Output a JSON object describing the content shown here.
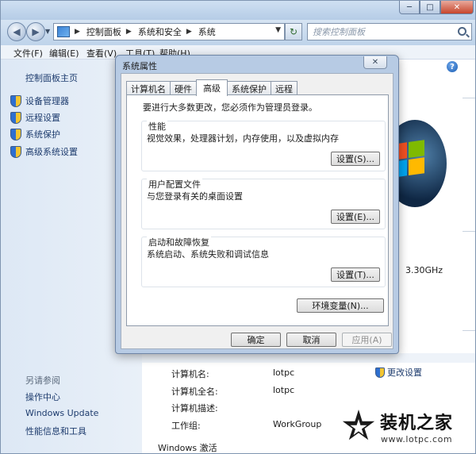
{
  "window": {
    "breadcrumbs": [
      "控制面板",
      "系统和安全",
      "系统"
    ],
    "search_placeholder": "搜索控制面板"
  },
  "menu": [
    "文件(F)",
    "编辑(E)",
    "查看(V)",
    "工具(T)",
    "帮助(H)"
  ],
  "sidebar": {
    "home": "控制面板主页",
    "items": [
      "设备管理器",
      "远程设置",
      "系统保护",
      "高级系统设置"
    ],
    "see_also_title": "另请参阅",
    "see_also": [
      "操作中心",
      "Windows Update",
      "性能信息和工具"
    ]
  },
  "main": {
    "cpu_speed": "3.30GHz",
    "computer_info": [
      {
        "label": "计算机名:",
        "value": "lotpc"
      },
      {
        "label": "计算机全名:",
        "value": "lotpc"
      },
      {
        "label": "计算机描述:",
        "value": ""
      },
      {
        "label": "工作组:",
        "value": "WorkGroup"
      }
    ],
    "change_settings": "更改设置",
    "activation": "Windows 激活"
  },
  "watermark": {
    "title": "装机之家",
    "url": "www.lotpc.com"
  },
  "dialog": {
    "title": "系统属性",
    "tabs": [
      "计算机名",
      "硬件",
      "高级",
      "系统保护",
      "远程"
    ],
    "active_tab": "高级",
    "admin_note": "要进行大多数更改，您必须作为管理员登录。",
    "performance": {
      "title": "性能",
      "desc": "视觉效果，处理器计划，内存使用，以及虚拟内存",
      "button": "设置(S)..."
    },
    "user_profiles": {
      "title": "用户配置文件",
      "desc": "与您登录有关的桌面设置",
      "button": "设置(E)..."
    },
    "startup": {
      "title": "启动和故障恢复",
      "desc": "系统启动、系统失败和调试信息",
      "button": "设置(T)..."
    },
    "env_button": "环境变量(N)...",
    "ok": "确定",
    "cancel": "取消",
    "apply": "应用(A)"
  }
}
